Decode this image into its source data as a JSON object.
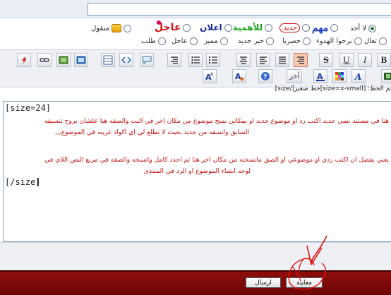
{
  "title_field": {
    "value": ""
  },
  "options": {
    "row1": [
      {
        "key": "none",
        "label": "لا أحد",
        "selected": true
      },
      {
        "key": "important",
        "label": "مهم"
      },
      {
        "key": "new",
        "label": "جديد"
      },
      {
        "key": "top",
        "label": "للأهمية"
      },
      {
        "key": "announce",
        "label": "اعلان"
      },
      {
        "key": "urgent",
        "label": "عاجل"
      },
      {
        "key": "quoted",
        "label": "منقول"
      }
    ],
    "row2": [
      {
        "key": "come",
        "label": "تعال"
      },
      {
        "key": "calm",
        "label": "نرجوا الهدوء"
      },
      {
        "key": "exclusive",
        "label": "حصريا"
      },
      {
        "key": "newnews",
        "label": "خبر جديد"
      },
      {
        "key": "distinct",
        "label": "مميز"
      },
      {
        "key": "urgent2",
        "label": "عاجل"
      },
      {
        "key": "request",
        "label": "طلب"
      }
    ]
  },
  "toolbar": {
    "font_size_caption": "حجم الخط: [size=x-small]خط صغير[/size]",
    "other_label": "آخر",
    "icons": [
      "flash-icon",
      "link-icon",
      "image-icon",
      "image-upload-icon",
      "table-icon",
      "code-icon",
      "quote-icon",
      "align-right-icon",
      "list-unordered-icon",
      "list-ordered-icon",
      "strike-icon",
      "underline-icon",
      "italic-icon",
      "bold-icon",
      "film-icon",
      "font-face-icon",
      "color-grid-icon",
      "font-color-icon",
      "other-button",
      "help-icon",
      "highlight-icon",
      "font-size-icon"
    ]
  },
  "editor": {
    "open_tag": "[size=24]",
    "close_tag": "[/size]",
    "lines": [
      "هنا في مستند نصي جديد اكتب رد او موضوع جديد او بمكاني  نسخ موضوع من مكان اخر في النت والصقه هنا علشان يروح تنسيقه",
      "السابق وانسقه من جديد بحيث لا تطلع لي اي اكواد غريبه في الموضوع,,,",
      "يعني  يفضل ان اكتب ردي او موضوعي او الصق مانسخته من مكان اخر هنا ثم احدد كامل وانسخه والصقه في مربع النص اللاي في",
      "لوحه انشاء الموضوع او الرد في المنتدى"
    ]
  },
  "footer": {
    "preview_label": "معاينة",
    "send_label": "ارسال"
  },
  "colors": {
    "footer_bar": "#7d0a0a",
    "message_text": "#c81414",
    "annotation": "#e01010"
  }
}
